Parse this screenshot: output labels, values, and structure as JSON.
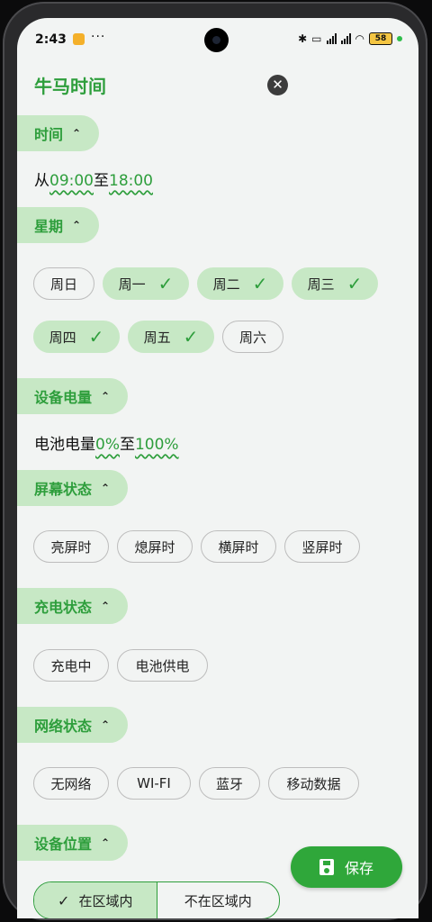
{
  "status": {
    "time": "2:43",
    "dots": "···",
    "battery": "58"
  },
  "header": {
    "title": "牛马时间",
    "close": "✕"
  },
  "time_section": {
    "label": "时间",
    "prefix": "从",
    "start": "09:00",
    "mid": "至",
    "end": "18:00"
  },
  "week_section": {
    "label": "星期",
    "days": [
      {
        "label": "周日",
        "selected": false
      },
      {
        "label": "周一",
        "selected": true
      },
      {
        "label": "周二",
        "selected": true
      },
      {
        "label": "周三",
        "selected": true
      },
      {
        "label": "周四",
        "selected": true
      },
      {
        "label": "周五",
        "selected": true
      },
      {
        "label": "周六",
        "selected": false
      }
    ]
  },
  "battery_section": {
    "label": "设备电量",
    "prefix": "电池电量",
    "min": "0%",
    "mid": "至",
    "max": "100%"
  },
  "screen_section": {
    "label": "屏幕状态",
    "options": [
      "亮屏时",
      "熄屏时",
      "横屏时",
      "竖屏时"
    ]
  },
  "charge_section": {
    "label": "充电状态",
    "options": [
      "充电中",
      "电池供电"
    ]
  },
  "network_section": {
    "label": "网络状态",
    "options": [
      "无网络",
      "WI-FI",
      "蓝牙",
      "移动数据"
    ]
  },
  "location_section": {
    "label": "设备位置",
    "inside": "在区域内",
    "outside": "不在区域内"
  },
  "save_label": "保存",
  "colors": {
    "accent": "#2e9e3c",
    "chip_selected": "#c7e8c5",
    "save": "#2fa73a"
  }
}
